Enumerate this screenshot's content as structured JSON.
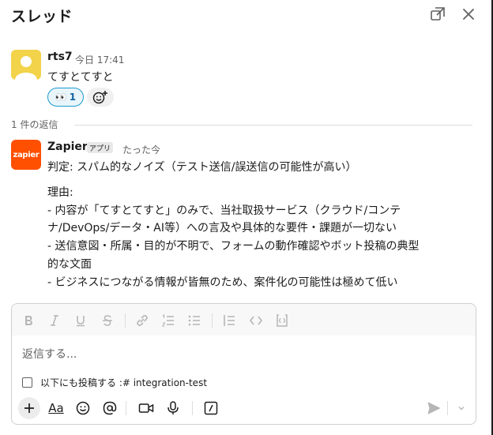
{
  "header": {
    "title": "スレッド"
  },
  "parent_message": {
    "author": "rts7",
    "time": "今日 17:41",
    "text": "てすとてすと",
    "reaction": {
      "emoji": "👀",
      "count": "1"
    }
  },
  "replies": {
    "label": "1 件の返信"
  },
  "reply_message": {
    "author": "Zapier",
    "avatar_text": "zapier",
    "badge": "アプリ",
    "time": "たった今",
    "lines": [
      "判定: スパム的なノイズ（テスト送信/誤送信の可能性が高い）",
      "理由:",
      "- 内容が「てすとてすと」のみで、当社取扱サービス（クラウド/コンテ",
      "ナ/DevOps/データ・AI等）への言及や具体的な要件・課題が一切ない",
      "- 送信意図・所属・目的が不明で、フォームの動作確認やボット投稿の典型",
      "的な文面",
      "- ビジネスにつながる情報が皆無のため、案件化の可能性は極めて低い"
    ]
  },
  "composer": {
    "placeholder": "返信する...",
    "also_post_label": "以下にも投稿する :# integration-test",
    "format_label": "Aa"
  },
  "colors": {
    "zapier_orange": "#ff4f00",
    "reaction_border": "#1d9bd1",
    "avatar_yellow": "#f2d34a"
  }
}
